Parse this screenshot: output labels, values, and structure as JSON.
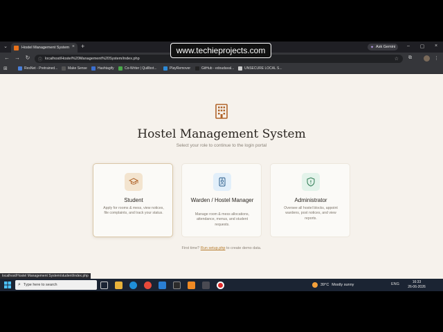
{
  "watermark": "www.techieprojects.com",
  "browser": {
    "tab_title": "Hostel Management System",
    "tab_close": "×",
    "tab_list": "⌄",
    "new_tab": "+",
    "ask_gemini": "Ask Gemini",
    "gemini_icon": "sparkle-icon",
    "window": {
      "minimize": "–",
      "restore": "▢",
      "close": "×"
    },
    "nav": {
      "back": "←",
      "forward": "→",
      "reload": "↻"
    },
    "url": "localhost/Hostel%20Management%20System/index.php",
    "bookmark_star": "☆",
    "bookmarks": [
      {
        "label": "ResNet - Pretrained...",
        "color": "#4a7fd8"
      },
      {
        "label": "Make Sense",
        "color": "#555555"
      },
      {
        "label": "Hashtagify",
        "color": "#3b6fd0"
      },
      {
        "label": "Co-Writer | Quillbot...",
        "color": "#4aa84a"
      },
      {
        "label": "PlayRemover",
        "color": "#2c8ad8"
      },
      {
        "label": "GitHub - edoudaval...",
        "color": "#222222"
      },
      {
        "label": "UNSECURE LOCAL S...",
        "color": "#cccccc"
      }
    ]
  },
  "page": {
    "title": "Hostel Management System",
    "subtitle": "Select your role to continue to the login portal",
    "brand_color": "#b0642a",
    "cards": [
      {
        "title": "Student",
        "description": "Apply for rooms & mess, view notices, file complaints, and track your status.",
        "icon": "graduation-cap-icon",
        "icon_bg": "#f3e4cf"
      },
      {
        "title": "Warden / Hostel Manager",
        "description": "Manage room & mess allocations, attendance, menus, and student requests.",
        "icon": "id-badge-icon",
        "icon_bg": "#e2effa"
      },
      {
        "title": "Administrator",
        "description": "Oversee all hostel blocks, appoint wardens, post notices, and view reports.",
        "icon": "shield-icon",
        "icon_bg": "#e3f3ea"
      }
    ],
    "first_time": {
      "prefix": "First time?",
      "link": "Run setup.php",
      "suffix": "to create demo data."
    }
  },
  "status_bar": "localhost/Hostel Management System/student/index.php",
  "taskbar": {
    "search_placeholder": "Type here to search",
    "weather_temp": "39°C",
    "weather_text": "Mostly sunny",
    "language": "ENG",
    "time": "16:33",
    "date": "26-06-2026"
  }
}
